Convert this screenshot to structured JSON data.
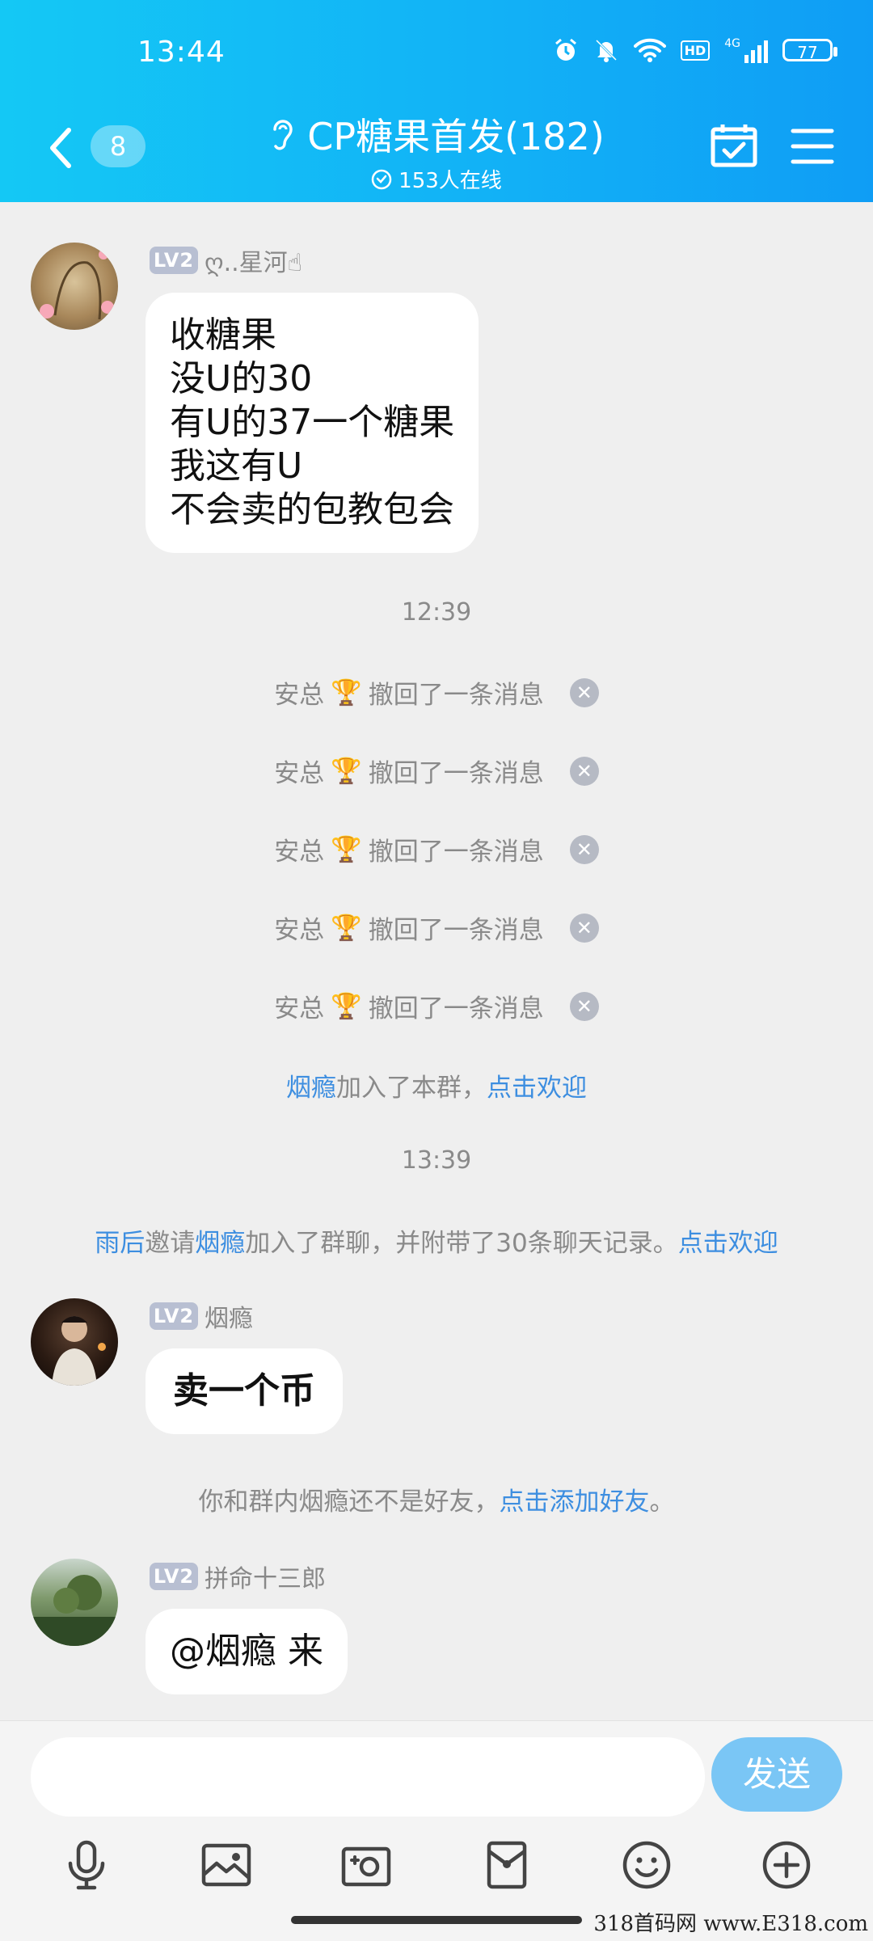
{
  "status": {
    "time": "13:44",
    "battery": "77",
    "network": "4G",
    "hd": "HD"
  },
  "header": {
    "unread_count": "8",
    "title": "CP糖果首发(182)",
    "online": "153人在线"
  },
  "messages": [
    {
      "level": "LV2",
      "sender": "ღ..星河☝",
      "lines": [
        "收糖果",
        "没U的30",
        "有U的37一个糖果",
        "我这有U",
        "不会卖的包教包会"
      ]
    },
    {
      "level": "LV2",
      "sender": "烟瘾",
      "text": "卖一个币"
    },
    {
      "level": "LV2",
      "sender": "拼命十三郎",
      "text": "@烟瘾 来"
    }
  ],
  "time_1": "12:39",
  "recalls": [
    {
      "name": "安总",
      "trophy": "🏆",
      "text": "撤回了一条消息"
    },
    {
      "name": "安总",
      "trophy": "🏆",
      "text": "撤回了一条消息"
    },
    {
      "name": "安总",
      "trophy": "🏆",
      "text": "撤回了一条消息"
    },
    {
      "name": "安总",
      "trophy": "🏆",
      "text": "撤回了一条消息"
    },
    {
      "name": "安总",
      "trophy": "🏆",
      "text": "撤回了一条消息"
    }
  ],
  "recall_close": "✕",
  "join_notice": {
    "name": "烟瘾",
    "text": "加入了本群，",
    "link": "点击欢迎"
  },
  "time_2": "13:39",
  "invite_notice": {
    "inviter": "雨后",
    "verb": "邀请",
    "invitee": "烟瘾",
    "text": "加入了群聊，并附带了30条聊天记录。",
    "link": "点击欢迎"
  },
  "friend_notice": {
    "text": "你和群内烟瘾还不是好友，",
    "link": "点击添加好友",
    "end": "。"
  },
  "input": {
    "placeholder": "",
    "send_label": "发送"
  },
  "toolbar": [
    "mic-icon",
    "image-icon",
    "camera-icon",
    "red-packet-icon",
    "emoji-icon",
    "plus-icon"
  ],
  "watermark": "318首码网 www.E318.com"
}
